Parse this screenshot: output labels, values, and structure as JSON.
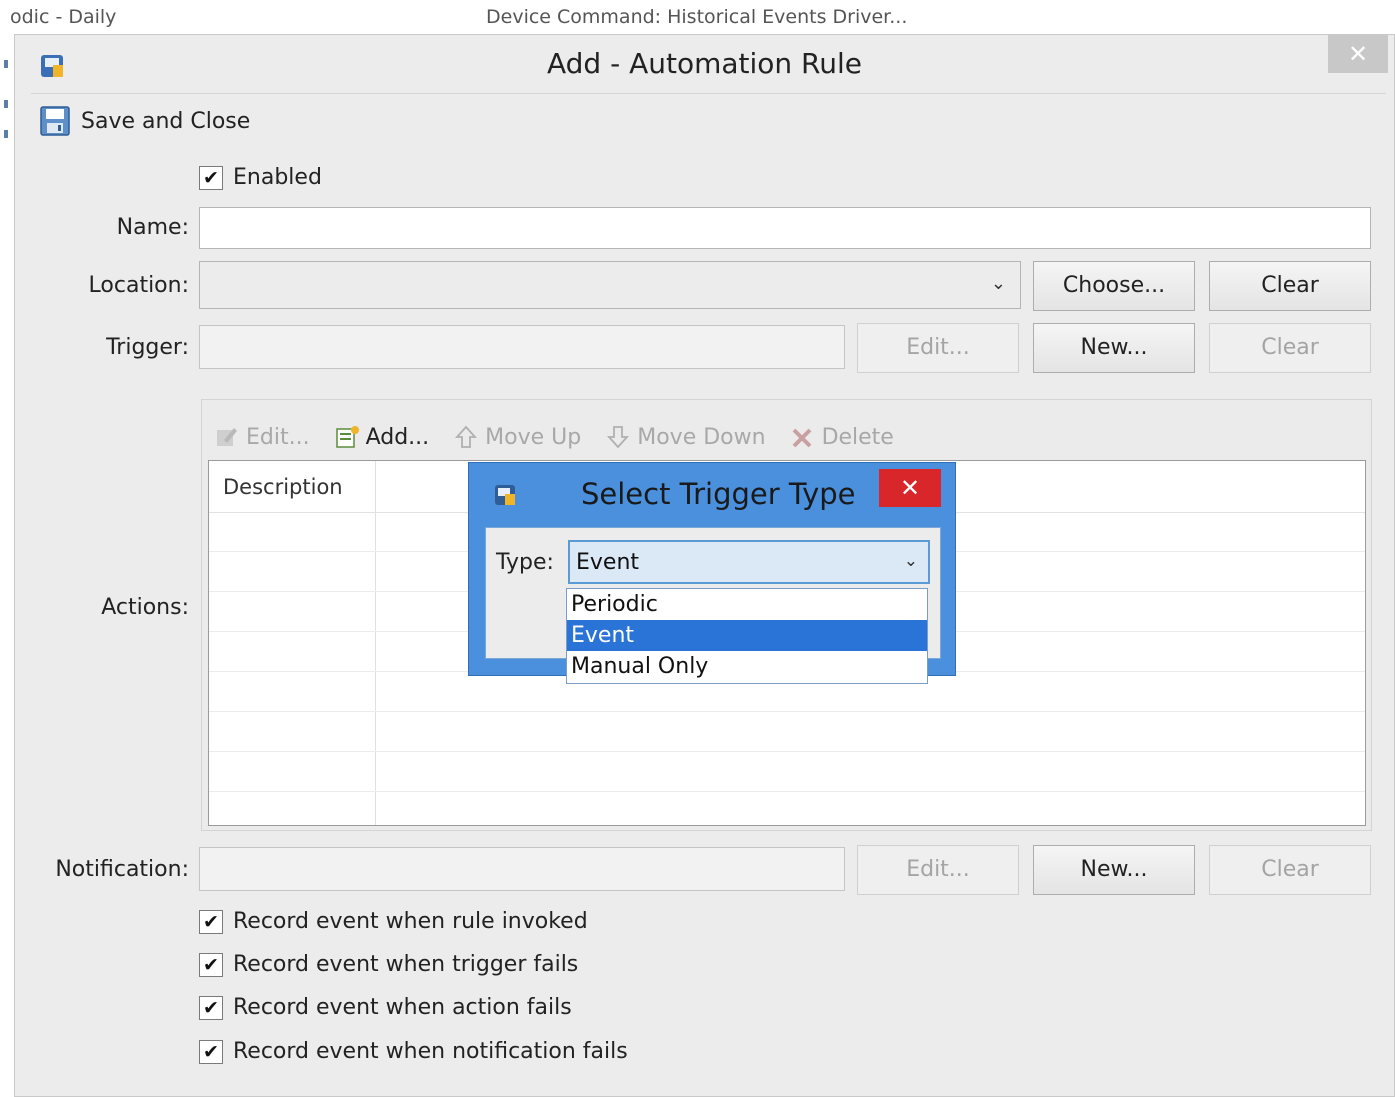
{
  "background": {
    "left_text": "odic - Daily",
    "center_text": "Device Command: Historical Events Driver..."
  },
  "window": {
    "title": "Add - Automation Rule",
    "close_glyph": "✕"
  },
  "toolbar": {
    "save_close_label": "Save and Close"
  },
  "form": {
    "enabled_label": "Enabled",
    "enabled_checked": "✔",
    "name_label": "Name:",
    "name_value": "",
    "location_label": "Location:",
    "location_value": "",
    "location_chevron": "⌄",
    "choose_label": "Choose...",
    "clear_label": "Clear",
    "trigger_label": "Trigger:",
    "trigger_value": "",
    "edit_label": "Edit...",
    "new_label": "New...",
    "actions_label": "Actions:",
    "notification_label": "Notification:",
    "notification_value": ""
  },
  "actions": {
    "toolbar": {
      "edit": "Edit...",
      "add": "Add...",
      "move_up": "Move Up",
      "move_down": "Move Down",
      "delete": "Delete"
    },
    "columns": [
      "Description"
    ]
  },
  "record_options": [
    {
      "label": "Record event when rule invoked",
      "checked": "✔"
    },
    {
      "label": "Record event when trigger fails",
      "checked": "✔"
    },
    {
      "label": "Record event when action fails",
      "checked": "✔"
    },
    {
      "label": "Record event when notification fails",
      "checked": "✔"
    }
  ],
  "popup": {
    "title": "Select Trigger Type",
    "close_glyph": "✕",
    "type_label": "Type:",
    "type_value": "Event",
    "chevron": "⌄",
    "options": [
      "Periodic",
      "Event",
      "Manual Only"
    ],
    "selected_option": "Event"
  },
  "colors": {
    "popup_frame": "#4a90dd",
    "popup_close": "#d8262a",
    "selected_option": "#2a74d8"
  }
}
